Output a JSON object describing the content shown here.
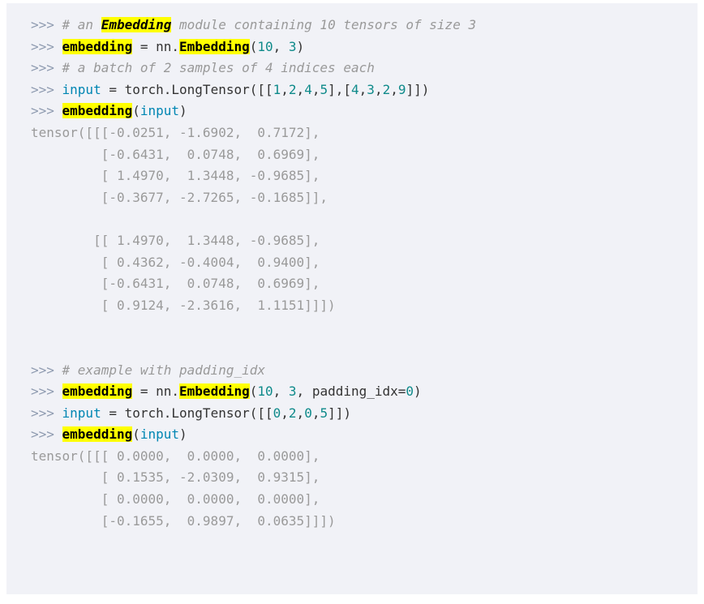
{
  "block": {
    "kind": "python-doctest-code-block",
    "background_color": "#f1f2f7",
    "page_background": "#ffffff",
    "colors": {
      "prompt": "#8f9bb0",
      "comment": "#999999",
      "plain_text": "#333333",
      "number_literal": "#0e8a8a",
      "variable_name": "#0086b3",
      "output_text": "#9a9a9a",
      "highlight_background": "#ffff00",
      "highlight_text": "#000000"
    }
  },
  "lines": [
    {
      "id": "line-1",
      "type": "input",
      "prompt": ">>> ",
      "tokens": [
        {
          "t": "comment",
          "v": "# an "
        },
        {
          "t": "hl-comment",
          "v": "Embedding"
        },
        {
          "t": "comment",
          "v": " module containing 10 tensors of size 3"
        }
      ]
    },
    {
      "id": "line-2",
      "type": "input",
      "prompt": ">>> ",
      "tokens": [
        {
          "t": "hl",
          "v": "embedding"
        },
        {
          "t": "plain",
          "v": " = nn."
        },
        {
          "t": "hl",
          "v": "Embedding"
        },
        {
          "t": "plain",
          "v": "("
        },
        {
          "t": "num",
          "v": "10"
        },
        {
          "t": "plain",
          "v": ", "
        },
        {
          "t": "num",
          "v": "3"
        },
        {
          "t": "plain",
          "v": ")"
        }
      ]
    },
    {
      "id": "line-3",
      "type": "input",
      "prompt": ">>> ",
      "tokens": [
        {
          "t": "comment",
          "v": "# a batch of 2 samples of 4 indices each"
        }
      ]
    },
    {
      "id": "line-4",
      "type": "input",
      "prompt": ">>> ",
      "tokens": [
        {
          "t": "name",
          "v": "input"
        },
        {
          "t": "plain",
          "v": " = torch.LongTensor([["
        },
        {
          "t": "num",
          "v": "1"
        },
        {
          "t": "plain",
          "v": ","
        },
        {
          "t": "num",
          "v": "2"
        },
        {
          "t": "plain",
          "v": ","
        },
        {
          "t": "num",
          "v": "4"
        },
        {
          "t": "plain",
          "v": ","
        },
        {
          "t": "num",
          "v": "5"
        },
        {
          "t": "plain",
          "v": "],["
        },
        {
          "t": "num",
          "v": "4"
        },
        {
          "t": "plain",
          "v": ","
        },
        {
          "t": "num",
          "v": "3"
        },
        {
          "t": "plain",
          "v": ","
        },
        {
          "t": "num",
          "v": "2"
        },
        {
          "t": "plain",
          "v": ","
        },
        {
          "t": "num",
          "v": "9"
        },
        {
          "t": "plain",
          "v": "]])"
        }
      ]
    },
    {
      "id": "line-5",
      "type": "input",
      "prompt": ">>> ",
      "tokens": [
        {
          "t": "hl",
          "v": "embedding"
        },
        {
          "t": "plain",
          "v": "("
        },
        {
          "t": "name",
          "v": "input"
        },
        {
          "t": "plain",
          "v": ")"
        }
      ]
    },
    {
      "id": "line-6",
      "type": "output",
      "text": "tensor([[[-0.0251, -1.6902,  0.7172],"
    },
    {
      "id": "line-7",
      "type": "output",
      "text": "         [-0.6431,  0.0748,  0.6969],"
    },
    {
      "id": "line-8",
      "type": "output",
      "text": "         [ 1.4970,  1.3448, -0.9685],"
    },
    {
      "id": "line-9",
      "type": "output",
      "text": "         [-0.3677, -2.7265, -0.1685]],"
    },
    {
      "id": "line-10",
      "type": "blank",
      "text": ""
    },
    {
      "id": "line-11",
      "type": "output",
      "text": "        [[ 1.4970,  1.3448, -0.9685],"
    },
    {
      "id": "line-12",
      "type": "output",
      "text": "         [ 0.4362, -0.4004,  0.9400],"
    },
    {
      "id": "line-13",
      "type": "output",
      "text": "         [-0.6431,  0.0748,  0.6969],"
    },
    {
      "id": "line-14",
      "type": "output",
      "text": "         [ 0.9124, -2.3616,  1.1151]]])"
    },
    {
      "id": "line-15",
      "type": "blank",
      "text": ""
    },
    {
      "id": "line-16",
      "type": "blank",
      "text": ""
    },
    {
      "id": "line-17",
      "type": "input",
      "prompt": ">>> ",
      "tokens": [
        {
          "t": "comment",
          "v": "# example with padding_idx"
        }
      ]
    },
    {
      "id": "line-18",
      "type": "input",
      "prompt": ">>> ",
      "tokens": [
        {
          "t": "hl",
          "v": "embedding"
        },
        {
          "t": "plain",
          "v": " = nn."
        },
        {
          "t": "hl",
          "v": "Embedding"
        },
        {
          "t": "plain",
          "v": "("
        },
        {
          "t": "num",
          "v": "10"
        },
        {
          "t": "plain",
          "v": ", "
        },
        {
          "t": "num",
          "v": "3"
        },
        {
          "t": "plain",
          "v": ", padding_idx="
        },
        {
          "t": "num",
          "v": "0"
        },
        {
          "t": "plain",
          "v": ")"
        }
      ]
    },
    {
      "id": "line-19",
      "type": "input",
      "prompt": ">>> ",
      "tokens": [
        {
          "t": "name",
          "v": "input"
        },
        {
          "t": "plain",
          "v": " = torch.LongTensor([["
        },
        {
          "t": "num",
          "v": "0"
        },
        {
          "t": "plain",
          "v": ","
        },
        {
          "t": "num",
          "v": "2"
        },
        {
          "t": "plain",
          "v": ","
        },
        {
          "t": "num",
          "v": "0"
        },
        {
          "t": "plain",
          "v": ","
        },
        {
          "t": "num",
          "v": "5"
        },
        {
          "t": "plain",
          "v": "]])"
        }
      ]
    },
    {
      "id": "line-20",
      "type": "input",
      "prompt": ">>> ",
      "tokens": [
        {
          "t": "hl",
          "v": "embedding"
        },
        {
          "t": "plain",
          "v": "("
        },
        {
          "t": "name",
          "v": "input"
        },
        {
          "t": "plain",
          "v": ")"
        }
      ]
    },
    {
      "id": "line-21",
      "type": "output",
      "text": "tensor([[[ 0.0000,  0.0000,  0.0000],"
    },
    {
      "id": "line-22",
      "type": "output",
      "text": "         [ 0.1535, -2.0309,  0.9315],"
    },
    {
      "id": "line-23",
      "type": "output",
      "text": "         [ 0.0000,  0.0000,  0.0000],"
    },
    {
      "id": "line-24",
      "type": "output",
      "text": "         [-0.1655,  0.9897,  0.0635]]])"
    }
  ]
}
